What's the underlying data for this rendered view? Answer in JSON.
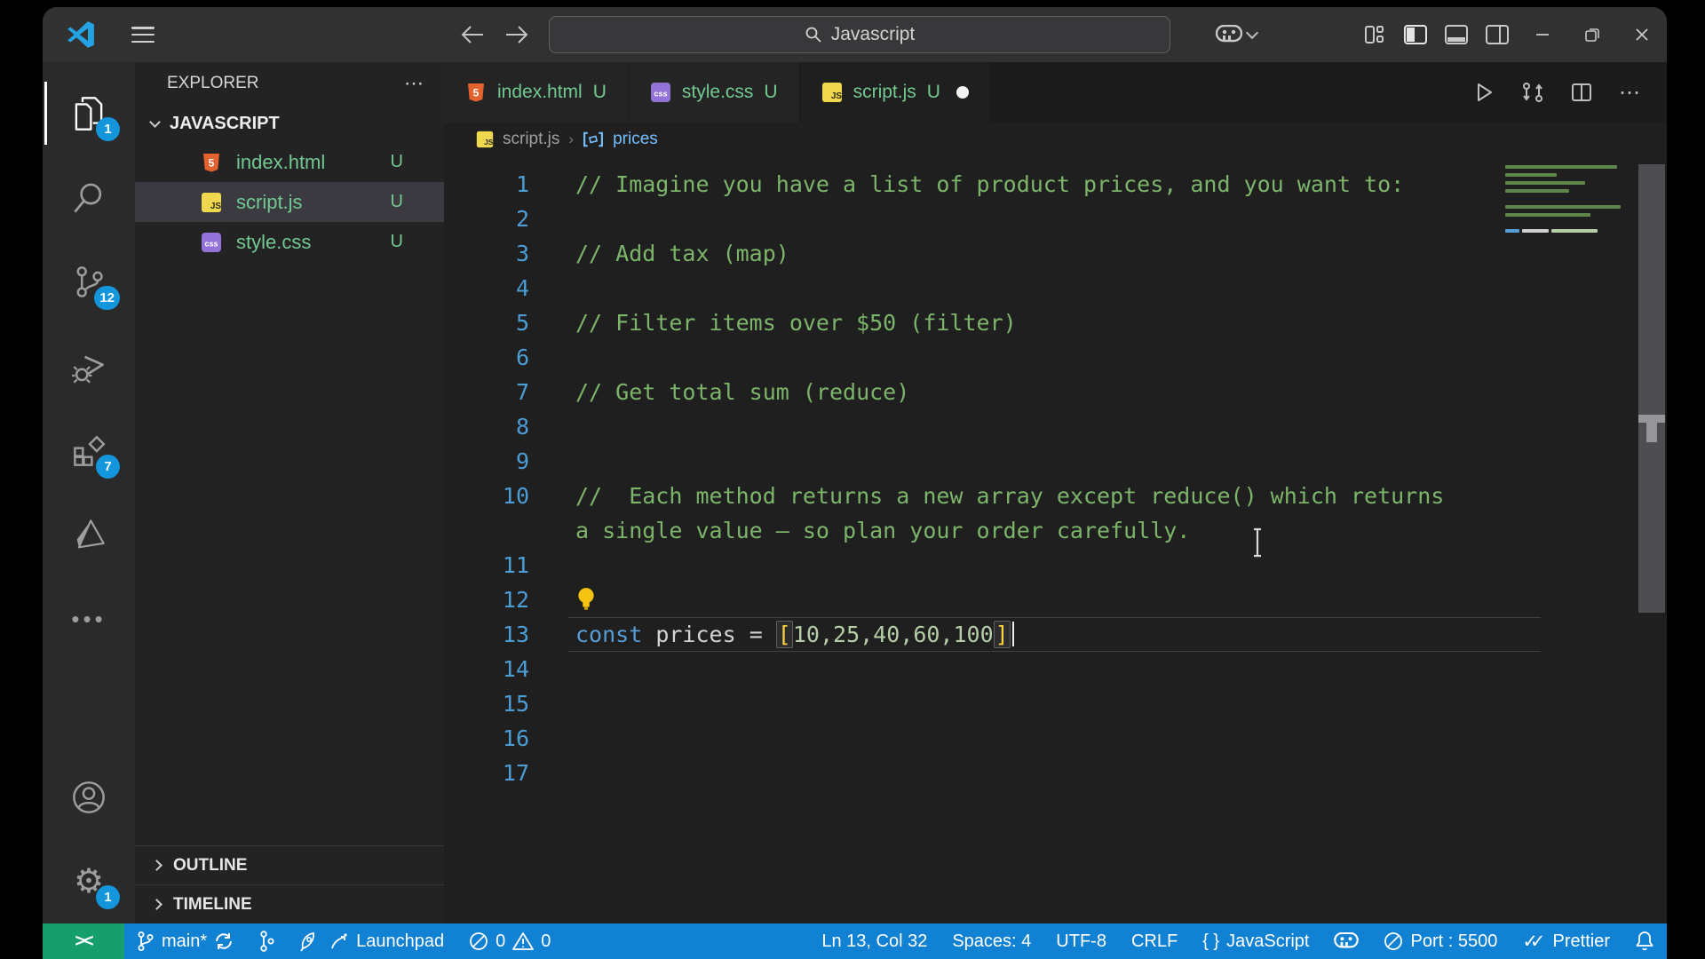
{
  "titlebar": {
    "search_value": "Javascript"
  },
  "activity_bar": {
    "explorer_badge": "1",
    "source_control_badge": "12",
    "extensions_badge": "7",
    "settings_badge": "1"
  },
  "sidebar": {
    "title": "EXPLORER",
    "more": "⋯",
    "section": "JAVASCRIPT",
    "files": [
      {
        "name": "index.html",
        "git_status": "U"
      },
      {
        "name": "script.js",
        "git_status": "U"
      },
      {
        "name": "style.css",
        "git_status": "U"
      }
    ],
    "bottom_sections": [
      {
        "label": "OUTLINE"
      },
      {
        "label": "TIMELINE"
      }
    ]
  },
  "tabs": [
    {
      "label": "index.html",
      "git_status": "U"
    },
    {
      "label": "style.css",
      "git_status": "U"
    },
    {
      "label": "script.js",
      "git_status": "U"
    }
  ],
  "breadcrumb": {
    "file": "script.js",
    "separator": "›",
    "symbol": "prices"
  },
  "editor": {
    "lines": [
      {
        "num": "1",
        "text": "// Imagine you have a list of product prices, and you want to:"
      },
      {
        "num": "2",
        "text": ""
      },
      {
        "num": "3",
        "text": "// Add tax (map)"
      },
      {
        "num": "4",
        "text": ""
      },
      {
        "num": "5",
        "text": "// Filter items over $50 (filter)"
      },
      {
        "num": "6",
        "text": ""
      },
      {
        "num": "7",
        "text": "// Get total sum (reduce)"
      },
      {
        "num": "8",
        "text": ""
      },
      {
        "num": "9",
        "text": ""
      },
      {
        "num": "10",
        "text": "//  Each method returns a new array except reduce() which returns",
        "wrap_text": "a single value — so plan your order carefully."
      },
      {
        "num": "11",
        "text": ""
      },
      {
        "num": "12",
        "icon": "lightbulb-icon"
      },
      {
        "num": "13"
      },
      {
        "num": "14",
        "text": ""
      },
      {
        "num": "15",
        "text": ""
      },
      {
        "num": "16",
        "text": ""
      },
      {
        "num": "17",
        "text": ""
      }
    ],
    "line13": {
      "keyword": "const",
      "variable": " prices ",
      "operator": "= ",
      "open_bracket": "[",
      "values": "10,25,40,60,100",
      "close_bracket": "]"
    }
  },
  "status_bar": {
    "branch": "main*",
    "launchpad": "Launchpad",
    "errors": "0",
    "warnings": "0",
    "cursor": "Ln 13, Col 32",
    "spaces": "Spaces: 4",
    "encoding": "UTF-8",
    "eol": "CRLF",
    "language_braces": "{ }",
    "language": "JavaScript",
    "port": "Port : 5500",
    "formatter": "Prettier"
  }
}
